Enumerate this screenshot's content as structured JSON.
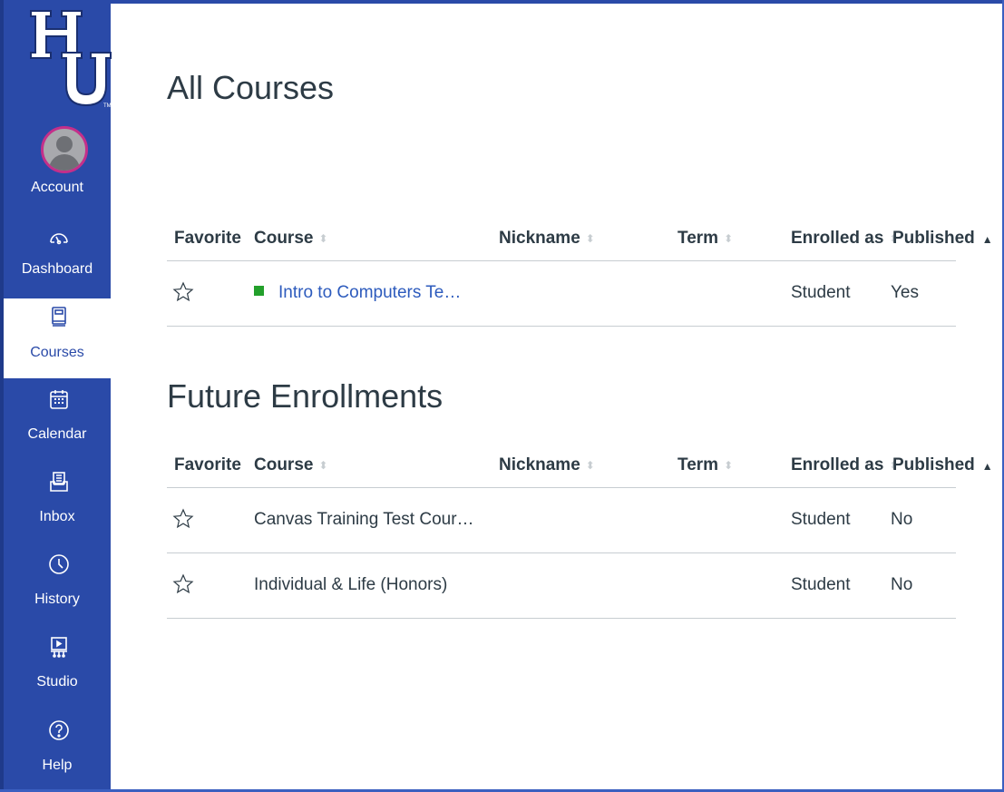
{
  "sidebar": {
    "logo_text": "HU",
    "items": [
      {
        "label": "Account"
      },
      {
        "label": "Dashboard"
      },
      {
        "label": "Courses"
      },
      {
        "label": "Calendar"
      },
      {
        "label": "Inbox"
      },
      {
        "label": "History"
      },
      {
        "label": "Studio"
      },
      {
        "label": "Help"
      }
    ]
  },
  "all_courses": {
    "title": "All Courses",
    "columns": [
      "Favorite",
      "Course",
      "Nickname",
      "Term",
      "Enrolled as",
      "Published"
    ],
    "rows": [
      {
        "course": "Intro to Computers Te…",
        "nickname": "",
        "term": "",
        "enrolled_as": "Student",
        "published": "Yes",
        "color": "#23a02b"
      }
    ]
  },
  "future_enrollments": {
    "title": "Future Enrollments",
    "columns": [
      "Favorite",
      "Course",
      "Nickname",
      "Term",
      "Enrolled as",
      "Published"
    ],
    "rows": [
      {
        "course": "Canvas Training Test Cour…",
        "nickname": "",
        "term": "",
        "enrolled_as": "Student",
        "published": "No"
      },
      {
        "course": "Individual & Life (Honors)",
        "nickname": "",
        "term": "",
        "enrolled_as": "Student",
        "published": "No"
      }
    ]
  },
  "colors": {
    "sidebar_bg": "#2a4aa8",
    "link": "#2d5bbd",
    "text": "#2d3b45"
  }
}
